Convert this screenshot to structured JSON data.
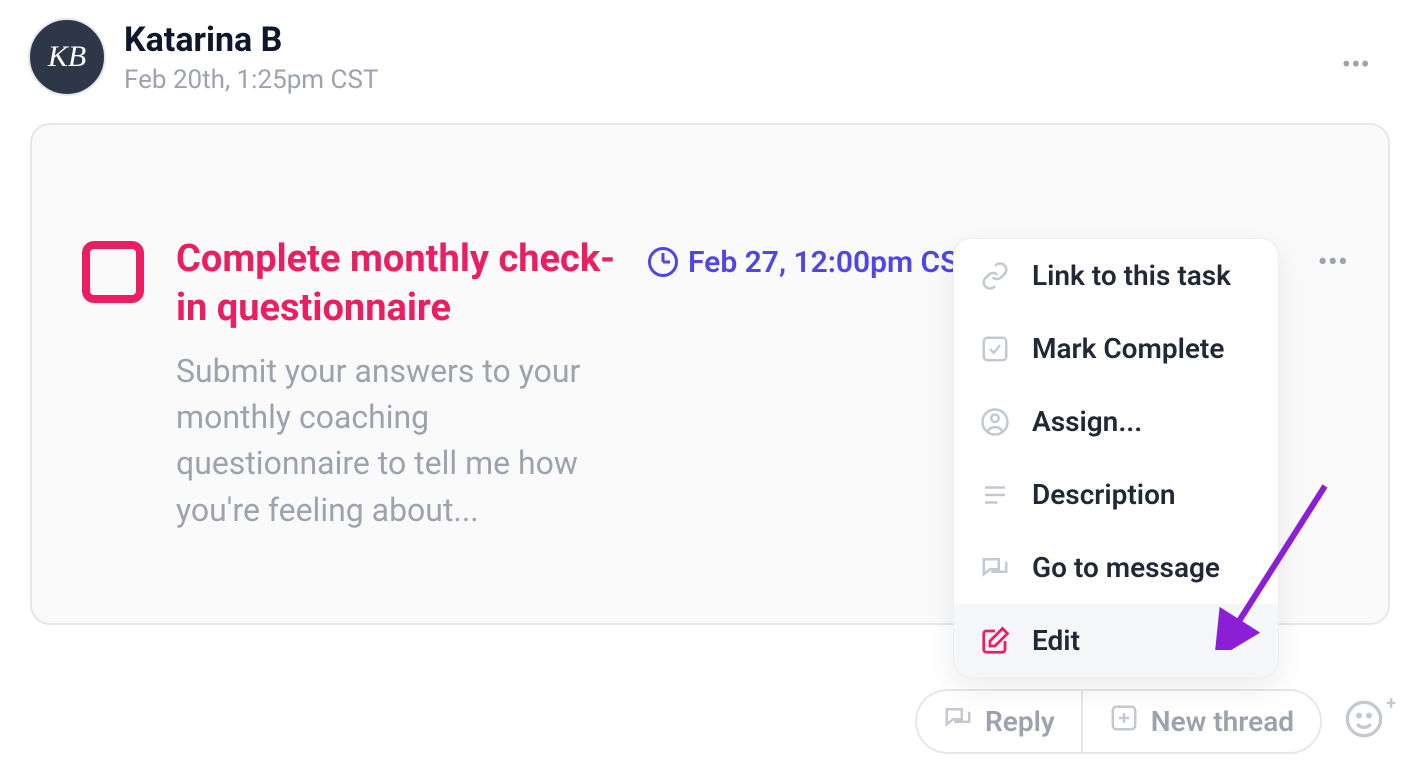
{
  "message": {
    "author": "Katarina B",
    "avatar_initials": "KB",
    "timestamp": "Feb 20th, 1:25pm CST"
  },
  "task": {
    "title": "Complete monthly check-in questionnaire",
    "description": "Submit your answers to your monthly coaching questionnaire to tell me how you're feeling about...",
    "due": "Feb 27, 12:00pm CST",
    "checked": false
  },
  "dropdown": {
    "items": [
      {
        "icon": "link-icon",
        "label": "Link to this task"
      },
      {
        "icon": "check-icon",
        "label": "Mark Complete"
      },
      {
        "icon": "user-icon",
        "label": "Assign..."
      },
      {
        "icon": "lines-icon",
        "label": "Description"
      },
      {
        "icon": "chat-icon",
        "label": "Go to message"
      },
      {
        "icon": "edit-icon",
        "label": "Edit",
        "highlight": true
      }
    ]
  },
  "footer": {
    "reply": "Reply",
    "new_thread": "New thread"
  },
  "colors": {
    "accent_pink": "#e91e63",
    "accent_indigo": "#4f46e5",
    "annotation_purple": "#8b1fd6",
    "text_muted": "#9ca3af"
  }
}
